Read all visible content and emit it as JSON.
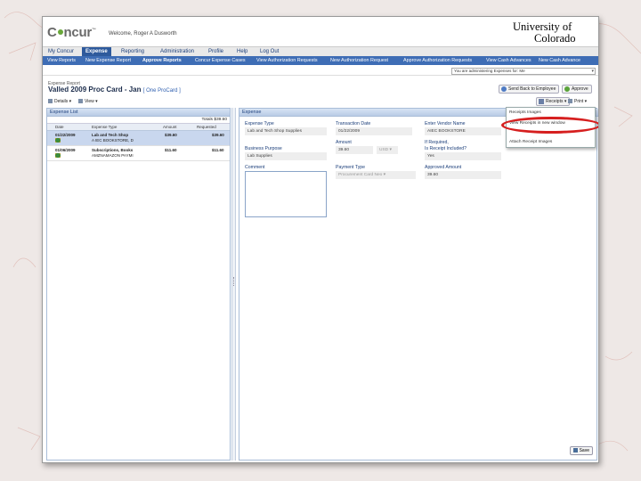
{
  "header": {
    "logo": "Concur",
    "welcome": "Welcome, Roger A Dusworth",
    "university_line1": "University of",
    "university_line2": "Colorado"
  },
  "main_nav": [
    "My Concur",
    "Expense",
    "Reporting",
    "Administration",
    "Profile",
    "Help",
    "Log Out"
  ],
  "sub_nav": [
    "View Reports",
    "New Expense Report",
    "Approve Reports",
    "Concur Expense Cases",
    "View Authorization Requests",
    "New Authorization Request",
    "Approve Authorization Requests",
    "View Cash Advances",
    "New Cash Advance"
  ],
  "admin_select": "You are administering Expenses for:  Me",
  "report": {
    "subtitle": "Expense Report",
    "title": "Valled  2009 Proc Card - Jan",
    "title_link": "[ One ProCard ]"
  },
  "action_buttons": {
    "send_back": "Send Back to Employee",
    "approve": "Approve",
    "receipts": "Receipts",
    "print": "Print"
  },
  "toolbar": {
    "details": "Details",
    "view": "View"
  },
  "expense_list": {
    "title": "Expense List",
    "totals": "Totals $39.60",
    "columns": [
      "Date",
      "Expense Type",
      "Amount",
      "Requested"
    ],
    "rows": [
      {
        "date": "01/22/2009",
        "type": "Lab and Tech Shop",
        "vendor": "A IEC BOOKSTORE, D",
        "amount": "$39.60",
        "requested": "$39.60"
      },
      {
        "date": "01/06/2009",
        "type": "Subscriptions, Books",
        "vendor": "AMZNAMAZON PAYMI",
        "amount": "$11.60",
        "requested": "$11.60"
      }
    ]
  },
  "expense_form": {
    "tab": "Expense",
    "expense_type_label": "Expense Type",
    "expense_type_value": "Lab and Tech Shop Supplies",
    "transaction_date_label": "Transaction Date",
    "transaction_date_value": "01/22/2009",
    "vendor_label": "Enter Vendor Name",
    "vendor_value": "AIEC BOOKSTORE",
    "business_purpose_label": "Business Purpose",
    "business_purpose_value": "Lab Supplies",
    "amount_label": "Amount",
    "amount_value": "39.60",
    "currency_value": "USD",
    "if_required_label": "If Required,",
    "receipt_included_label": "Is Receipt Included?",
    "receipt_included_value": "Yes",
    "comment_label": "Comment",
    "payment_type_label": "Payment Type",
    "payment_type_value": "Procurement Card Neo",
    "approved_amount_label": "Approved Amount",
    "approved_amount_value": "39.60",
    "save": "Save"
  },
  "receipts_menu": [
    "Receipts Images",
    "View Receipts in new window",
    "Attach Receipt Images"
  ],
  "colors": {
    "nav_blue": "#3e6db5",
    "highlight_red": "#d61f1f",
    "concur_green": "#69a73a"
  }
}
